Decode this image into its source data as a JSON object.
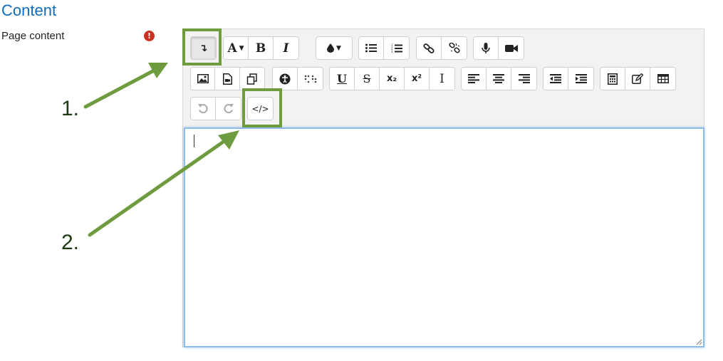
{
  "section": {
    "title": "Content"
  },
  "field": {
    "label": "Page content",
    "required_glyph": "!"
  },
  "toolbar": {
    "row1": [
      {
        "group": "toggle",
        "buttons": [
          {
            "name": "show-more-buttons",
            "glyph": "↴",
            "state": "active"
          }
        ]
      },
      {
        "group": "style",
        "buttons": [
          {
            "name": "paragraph-styles",
            "glyph": "A",
            "dropdown": true
          },
          {
            "name": "bold",
            "glyph": "B"
          },
          {
            "name": "italic",
            "glyph": "I"
          }
        ]
      },
      {
        "group": "color",
        "buttons": [
          {
            "name": "font-color",
            "glyph": "●",
            "dropdown": true
          }
        ]
      },
      {
        "group": "lists",
        "buttons": [
          {
            "name": "unordered-list",
            "glyph": "☰"
          },
          {
            "name": "ordered-list",
            "glyph": "≡"
          }
        ]
      },
      {
        "group": "links",
        "buttons": [
          {
            "name": "link",
            "glyph": "🔗"
          },
          {
            "name": "unlink",
            "glyph": "⛓"
          }
        ]
      },
      {
        "group": "media",
        "buttons": [
          {
            "name": "record-audio",
            "glyph": "🎤"
          },
          {
            "name": "record-video",
            "glyph": "■"
          }
        ]
      }
    ],
    "row2": [
      {
        "group": "files",
        "buttons": [
          {
            "name": "insert-image",
            "glyph": "▣"
          },
          {
            "name": "insert-media",
            "glyph": "▤"
          },
          {
            "name": "manage-files",
            "glyph": "❐"
          }
        ]
      },
      {
        "group": "accessibility",
        "buttons": [
          {
            "name": "accessibility-checker",
            "glyph": "◉"
          },
          {
            "name": "screenreader-helper",
            "glyph": "⠿"
          }
        ]
      },
      {
        "group": "formatting",
        "buttons": [
          {
            "name": "underline",
            "glyph": "U"
          },
          {
            "name": "strikethrough",
            "glyph": "S"
          },
          {
            "name": "subscript",
            "glyph": "x₂"
          },
          {
            "name": "superscript",
            "glyph": "x²"
          },
          {
            "name": "clear-formatting",
            "glyph": "I"
          }
        ]
      },
      {
        "group": "align",
        "buttons": [
          {
            "name": "align-left",
            "glyph": "≡"
          },
          {
            "name": "align-center",
            "glyph": "≡"
          },
          {
            "name": "align-right",
            "glyph": "≡"
          }
        ]
      },
      {
        "group": "indent",
        "buttons": [
          {
            "name": "outdent",
            "glyph": "⇤"
          },
          {
            "name": "indent",
            "glyph": "⇥"
          }
        ]
      },
      {
        "group": "insert",
        "buttons": [
          {
            "name": "equation",
            "glyph": "▦"
          },
          {
            "name": "character-map",
            "glyph": "✎"
          },
          {
            "name": "table",
            "glyph": "▦"
          }
        ]
      }
    ],
    "row3": [
      {
        "group": "history",
        "buttons": [
          {
            "name": "undo",
            "glyph": "↺",
            "state": "disabled"
          },
          {
            "name": "redo",
            "glyph": "↻",
            "state": "disabled"
          }
        ]
      },
      {
        "group": "html",
        "buttons": [
          {
            "name": "html-source",
            "glyph": "</>"
          }
        ]
      }
    ]
  },
  "annotations": {
    "step1": "1.",
    "step2": "2.",
    "arrow_color": "#6f9b3f"
  },
  "editor": {
    "content": ""
  }
}
